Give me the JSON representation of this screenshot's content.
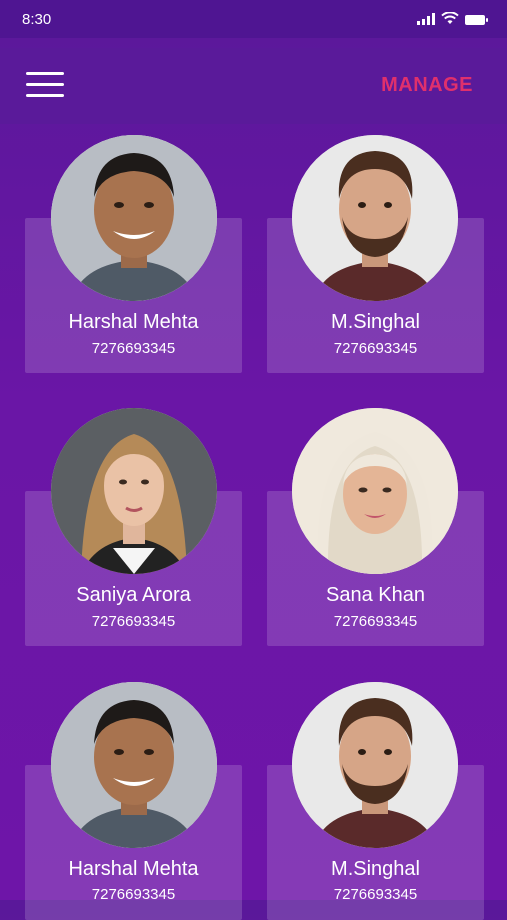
{
  "status": {
    "time": "8:30"
  },
  "header": {
    "manage_label": "MANAGE"
  },
  "contacts": [
    {
      "name": "Harshal Mehta",
      "phone": "7276693345",
      "avatar": "man-smiling-avatar"
    },
    {
      "name": "M.Singhal",
      "phone": "7276693345",
      "avatar": "bearded-man-avatar"
    },
    {
      "name": "Saniya Arora",
      "phone": "7276693345",
      "avatar": "blonde-woman-avatar"
    },
    {
      "name": "Sana Khan",
      "phone": "7276693345",
      "avatar": "woman-hijab-avatar"
    },
    {
      "name": "Harshal Mehta",
      "phone": "7276693345",
      "avatar": "man-smiling-avatar"
    },
    {
      "name": "M.Singhal",
      "phone": "7276693345",
      "avatar": "bearded-man-avatar"
    }
  ],
  "colors": {
    "background": "#6a16a6",
    "accent": "#e0306c",
    "card": "rgba(255,255,255,0.16)"
  }
}
